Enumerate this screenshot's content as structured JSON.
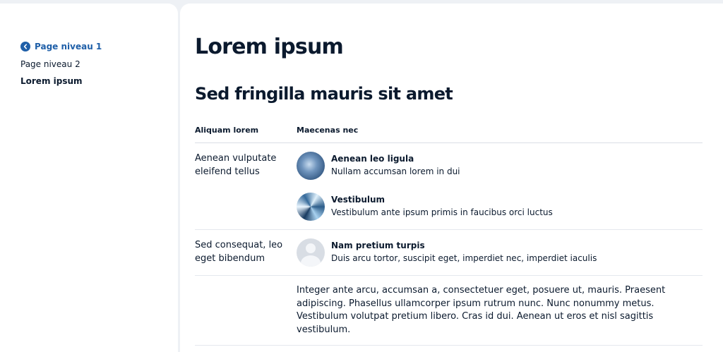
{
  "sidebar": {
    "back_label": "Page niveau 1",
    "items": [
      {
        "label": "Page niveau 2"
      },
      {
        "label": "Lorem ipsum"
      }
    ]
  },
  "main": {
    "title": "Lorem ipsum",
    "section_title": "Sed fringilla mauris sit amet",
    "table": {
      "headers": [
        "Aliquam lorem",
        "Maecenas nec"
      ],
      "rows": [
        {
          "label": "Aenean vulputate eleifend tellus",
          "entries": [
            {
              "title": "Aenean leo ligula",
              "subtitle": "Nullam accumsan lorem in dui"
            },
            {
              "title": "Vestibulum",
              "subtitle": "Vestibulum ante ipsum primis in faucibus orci luctus"
            }
          ]
        },
        {
          "label": "Sed consequat, leo eget bibendum",
          "entries": [
            {
              "title": "Nam pretium turpis",
              "subtitle": "Duis arcu tortor, suscipit eget, imperdiet nec, imperdiet iaculis"
            }
          ]
        },
        {
          "label": "",
          "paragraph": "Integer ante arcu, accumsan a, consectetuer eget, posuere ut, mauris. Praesent adipiscing. Phasellus ullamcorper ipsum rutrum nunc. Nunc nonummy metus. Vestibulum volutpat pretium libero. Cras id dui. Aenean ut eros et nisl sagittis vestibulum."
        }
      ]
    }
  },
  "colors": {
    "accent": "#1f5fa8",
    "text": "#0b1a2e",
    "page_background": "#eef1f5",
    "divider": "#d9dee5"
  },
  "icons": {
    "back": "chevron-left-icon"
  }
}
